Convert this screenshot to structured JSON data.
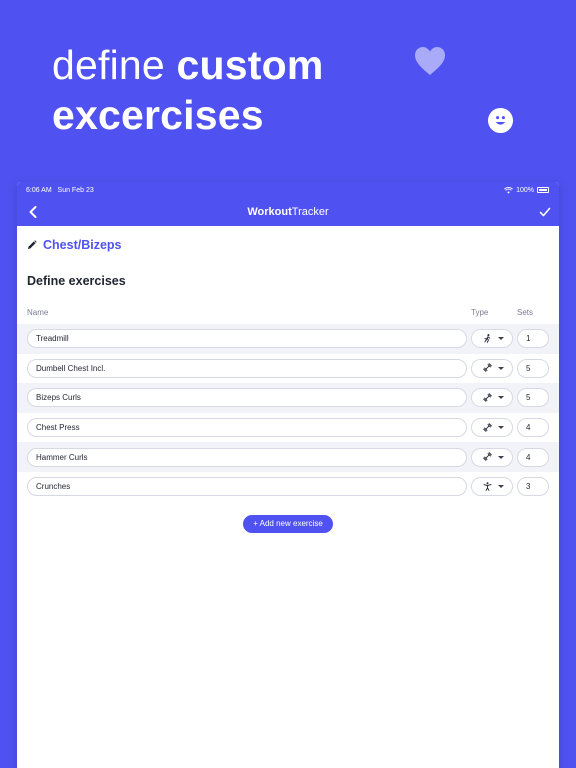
{
  "hero": {
    "line1_light": "define ",
    "line1_bold": "custom",
    "line2_bold": "excercises"
  },
  "status_bar": {
    "time": "6:06 AM",
    "date": "Sun Feb 23",
    "battery": "100%"
  },
  "nav": {
    "title_bold": "Workout",
    "title_regular": "Tracker",
    "back_icon": "chevron-left-icon",
    "done_icon": "checkmark-icon"
  },
  "workout": {
    "title": "Chest/Bizeps",
    "icon": "pencil-icon"
  },
  "section_title": "Define exercises",
  "columns": {
    "name": "Name",
    "type": "Type",
    "sets": "Sets"
  },
  "exercises": [
    {
      "name": "Treadmill",
      "type": "running-icon",
      "sets": "1"
    },
    {
      "name": "Dumbell Chest Incl.",
      "type": "dumbbell-icon",
      "sets": "5"
    },
    {
      "name": "Bizeps Curls",
      "type": "dumbbell-icon",
      "sets": "5"
    },
    {
      "name": "Chest Press",
      "type": "dumbbell-icon",
      "sets": "4"
    },
    {
      "name": "Hammer Curls",
      "type": "dumbbell-icon",
      "sets": "4"
    },
    {
      "name": "Crunches",
      "type": "body-icon",
      "sets": "3"
    }
  ],
  "add_button": "+ Add new exercise",
  "colors": {
    "brand": "#4f52f0",
    "row_alt": "#f1f3f9",
    "text_dark": "#1f2430"
  }
}
